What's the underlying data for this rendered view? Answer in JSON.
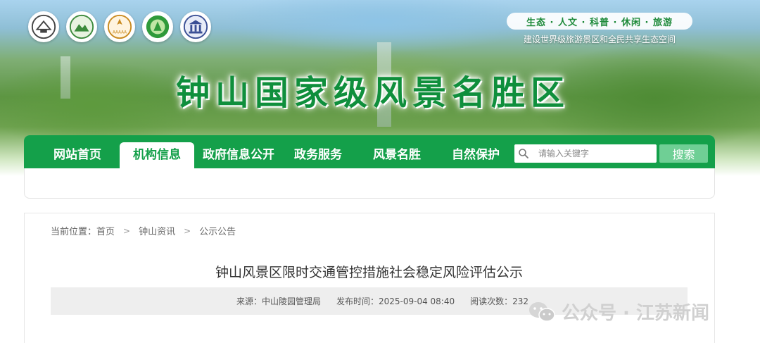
{
  "header": {
    "title": "钟山国家级风景名胜区",
    "slogan": "生态 · 人文 · 科普 · 休闲 · 旅游",
    "subtitle": "建设世界级旅游景区和全民共享生态空间"
  },
  "nav": {
    "items": [
      "网站首页",
      "机构信息",
      "政府信息公开",
      "政务服务",
      "风景名胜",
      "自然保护"
    ],
    "active": "机构信息"
  },
  "search": {
    "placeholder": "请输入关键字",
    "button_label": "搜索"
  },
  "breadcrumb": {
    "prefix": "当前位置：首页",
    "items": [
      "钟山资讯",
      "公示公告"
    ]
  },
  "article": {
    "title": "钟山风景区限时交通管控措施社会稳定风险评估公示",
    "source": "来源：中山陵园管理局",
    "publish_time": "发布时间：2025-09-04 08:40",
    "views": "阅读次数：232"
  },
  "watermark": {
    "text": "公众号 · 江苏新闻"
  }
}
